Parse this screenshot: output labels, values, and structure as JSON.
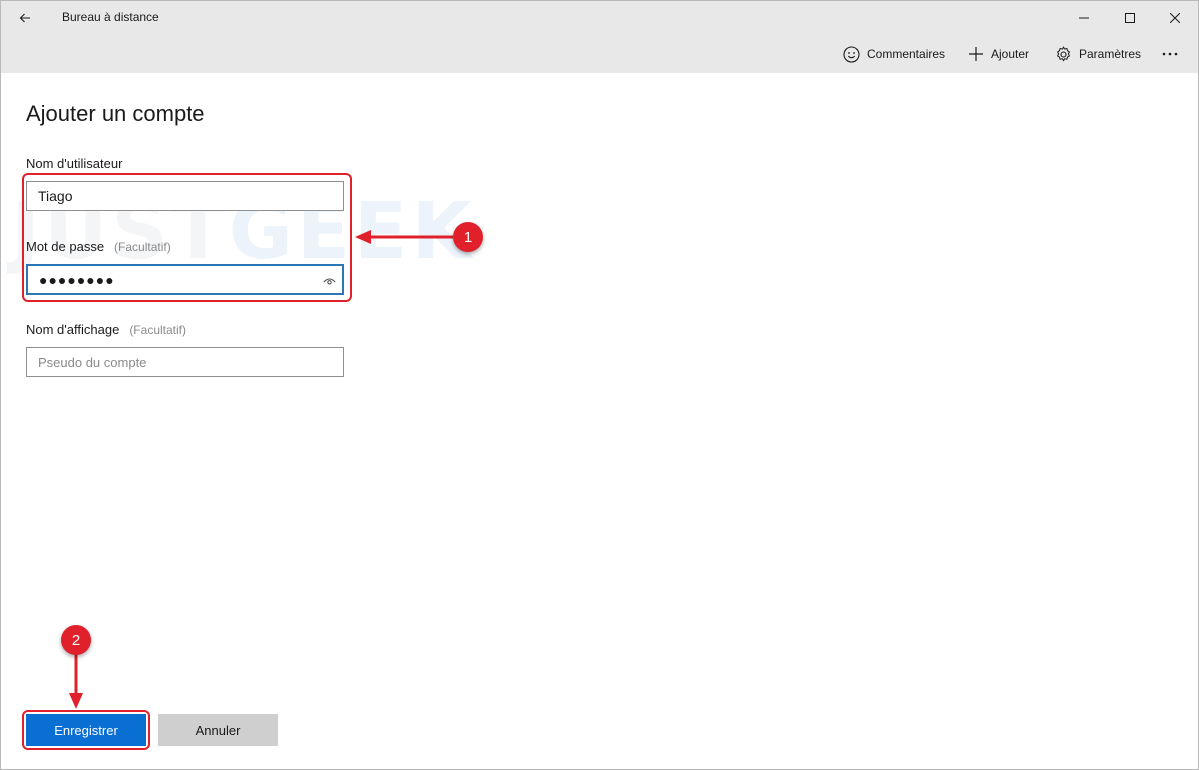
{
  "window": {
    "title": "Bureau à distance"
  },
  "command_bar": {
    "feedback_label": "Commentaires",
    "add_label": "Ajouter",
    "settings_label": "Paramètres"
  },
  "page": {
    "heading": "Ajouter un compte"
  },
  "form": {
    "username_label": "Nom d'utilisateur",
    "username_value": "Tiago",
    "password_label": "Mot de passe",
    "password_optional": "(Facultatif)",
    "password_value": "●●●●●●●●",
    "display_name_label": "Nom d'affichage",
    "display_name_optional": "(Facultatif)",
    "display_name_placeholder": "Pseudo du compte"
  },
  "buttons": {
    "save_label": "Enregistrer",
    "cancel_label": "Annuler"
  },
  "annotations": {
    "step1": "1",
    "step2": "2",
    "accent_color": "#e0202a"
  },
  "watermark": {
    "part1": "JUST",
    "part2": "GEEK"
  },
  "colors": {
    "primary_button": "#0a6fd3",
    "titlebar": "#e8e8e8",
    "focus_border": "#2b77b5"
  }
}
